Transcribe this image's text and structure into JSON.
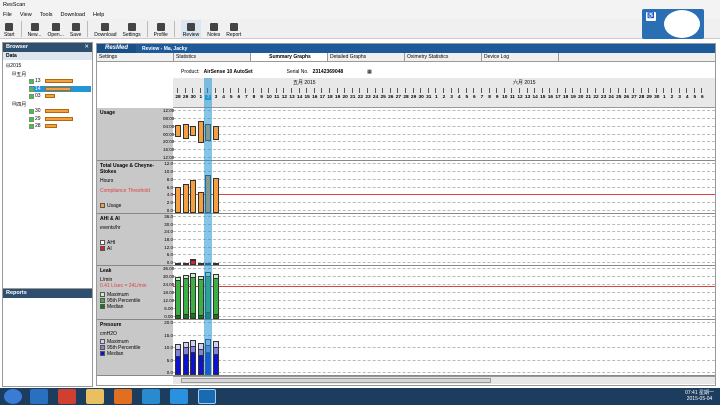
{
  "window": {
    "title": "ResScan"
  },
  "menu": [
    "File",
    "View",
    "Tools",
    "Download",
    "Help"
  ],
  "toolbar": [
    "Start",
    "New...",
    "Open...",
    "Save",
    "Download",
    "Settings",
    "Profile",
    "Review",
    "Notes",
    "Report"
  ],
  "browser": {
    "title": "Browser",
    "data_label": "Data",
    "year": "2015",
    "groups": [
      {
        "label": "五月",
        "items": [
          "13",
          "14",
          "03"
        ]
      },
      {
        "label": "四月",
        "items": [
          "30",
          "29",
          "28"
        ]
      }
    ]
  },
  "reports": {
    "title": "Reports"
  },
  "review": {
    "brand": "ResMed",
    "title": "Review - Ma, Jacky"
  },
  "tabs": [
    "Settings",
    "Statistics",
    "Summary Graphs",
    "Detailed Graphs",
    "Oximetry Statistics",
    "Device Log"
  ],
  "active_tab": "Summary Graphs",
  "product": {
    "label": "Product:",
    "value": "AirSense 10 AutoSet"
  },
  "serial": {
    "label": "Serial No.",
    "value": "23142369048"
  },
  "cal_icon": "calendar-icon",
  "calendar": {
    "months": [
      "五月 2015",
      "六月 2015"
    ],
    "days": [
      "28",
      "29",
      "30",
      "1",
      "2",
      "3",
      "4",
      "5",
      "6",
      "7",
      "8",
      "9",
      "10",
      "11",
      "12",
      "13",
      "14",
      "15",
      "16",
      "17",
      "18",
      "19",
      "20",
      "21",
      "22",
      "23",
      "24",
      "25",
      "26",
      "27",
      "28",
      "29",
      "30",
      "31",
      "1",
      "2",
      "3",
      "4",
      "5",
      "6",
      "7",
      "8",
      "9",
      "10",
      "11",
      "12",
      "13",
      "14",
      "15",
      "16",
      "17",
      "18",
      "19",
      "20",
      "21",
      "22",
      "23",
      "24",
      "25",
      "26",
      "27",
      "28",
      "29",
      "30",
      "1",
      "2",
      "3",
      "4",
      "5",
      "6"
    ],
    "selected_day": "2"
  },
  "sections": {
    "usage": {
      "title": "Usage",
      "ticks": [
        "12:00",
        "08:00",
        "04:00",
        "00:00",
        "20:00",
        "16:00",
        "12:00"
      ]
    },
    "total": {
      "title": "Total Usage & Cheyne-Stokes",
      "unit": "Hours",
      "compliance": "Compliance Threshold",
      "legend": "Usage",
      "ticks": [
        "12.0",
        "10.0",
        "8.0",
        "6.0",
        "4.0",
        "2.0",
        "0.0"
      ]
    },
    "ahi": {
      "title": "AHI & AI",
      "unit": "events/hr",
      "legend": [
        "AHI",
        "AI"
      ],
      "ticks": [
        "36.0",
        "30.0",
        "24.0",
        "18.0",
        "12.0",
        "6.0",
        "0.0"
      ]
    },
    "leak": {
      "title": "Leak",
      "unit": "L/min",
      "ref": "0.41 L/sec = 24L/min",
      "legend": [
        "Maximum",
        "95th Percentile",
        "Median"
      ],
      "ticks": [
        "36.00",
        "30.00",
        "24.00",
        "18.00",
        "12.00",
        "6.00",
        "0.00"
      ]
    },
    "pressure": {
      "title": "Pressure",
      "unit": "cmH2O",
      "legend": [
        "Maximum",
        "95th Percentile",
        "Median"
      ],
      "ticks": [
        "20.0",
        "15.0",
        "10.0",
        "5.0",
        "0.0"
      ]
    }
  },
  "colors": {
    "accent": "#2496d6",
    "usage": "#f5a040",
    "leak": "#3cb043",
    "pressure": "#1010d0",
    "ahi": "#e02020",
    "header": "#1d5a9a"
  },
  "clock": {
    "time": "07:41 星期一",
    "date": "2015-05-04"
  }
}
